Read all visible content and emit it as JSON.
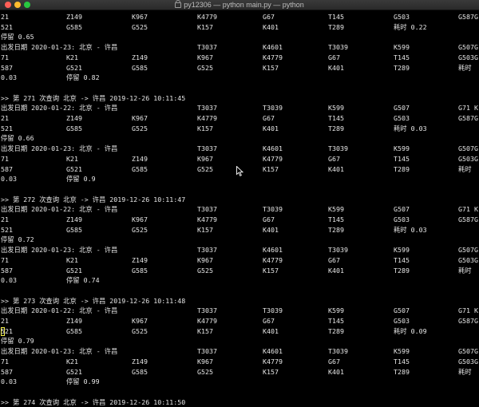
{
  "window": {
    "title": "py12306 — python main.py — python"
  },
  "terminal": {
    "lines": [
      [
        "21",
        "Z149",
        "K967",
        "K4779",
        "G67",
        "T145",
        "G503",
        "G587G"
      ],
      [
        "521",
        "G585",
        "G525",
        "K157",
        "K401",
        "T289",
        "耗时 0.22"
      ],
      [
        "停留 0.65"
      ],
      [
        "出发日期 2020-01-23: 北京 - 许昌",
        "T3037",
        "K4601",
        "T3039",
        "K599",
        "G507G"
      ],
      [
        "71",
        "K21",
        "Z149",
        "K967",
        "K4779",
        "G67",
        "T145",
        "G503G"
      ],
      [
        "587",
        "G521",
        "G585",
        "G525",
        "K157",
        "K401",
        "T289",
        "耗时"
      ],
      [
        "0.03",
        "停留 0.82"
      ],
      [
        ""
      ],
      [
        ">> 第 271 次查询 北京 -> 许昌 2019-12-26 10:11:45"
      ],
      [
        "出发日期 2020-01-22: 北京 - 许昌",
        "T3037",
        "T3039",
        "K599",
        "G507",
        "G71 K"
      ],
      [
        "21",
        "Z149",
        "K967",
        "K4779",
        "G67",
        "T145",
        "G503",
        "G587G"
      ],
      [
        "521",
        "G585",
        "G525",
        "K157",
        "K401",
        "T289",
        "耗时 0.03"
      ],
      [
        "停留 0.66"
      ],
      [
        "出发日期 2020-01-23: 北京 - 许昌",
        "T3037",
        "K4601",
        "T3039",
        "K599",
        "G507G"
      ],
      [
        "71",
        "K21",
        "Z149",
        "K967",
        "K4779",
        "G67",
        "T145",
        "G503G"
      ],
      [
        "587",
        "G521",
        "G585",
        "G525",
        "K157",
        "K401",
        "T289",
        "耗时"
      ],
      [
        "0.03",
        "停留 0.9"
      ],
      [
        ""
      ],
      [
        ">> 第 272 次查询 北京 -> 许昌 2019-12-26 10:11:47"
      ],
      [
        "出发日期 2020-01-22: 北京 - 许昌",
        "T3037",
        "T3039",
        "K599",
        "G507",
        "G71 K"
      ],
      [
        "21",
        "Z149",
        "K967",
        "K4779",
        "G67",
        "T145",
        "G503",
        "G587G"
      ],
      [
        "521",
        "G585",
        "G525",
        "K157",
        "K401",
        "T289",
        "耗时 0.03"
      ],
      [
        "停留 0.72"
      ],
      [
        "出发日期 2020-01-23: 北京 - 许昌",
        "T3037",
        "K4601",
        "T3039",
        "K599",
        "G507G"
      ],
      [
        "71",
        "K21",
        "Z149",
        "K967",
        "K4779",
        "G67",
        "T145",
        "G503G"
      ],
      [
        "587",
        "G521",
        "G585",
        "G525",
        "K157",
        "K401",
        "T289",
        "耗时"
      ],
      [
        "0.03",
        "停留 0.74"
      ],
      [
        ""
      ],
      [
        ">> 第 273 次查询 北京 -> 许昌 2019-12-26 10:11:48"
      ],
      [
        "出发日期 2020-01-22: 北京 - 许昌",
        "T3037",
        "T3039",
        "K599",
        "G507",
        "G71 K"
      ],
      [
        "21",
        "Z149",
        "K967",
        "K4779",
        "G67",
        "T145",
        "G503",
        "G587G"
      ],
      [
        "521",
        "G585",
        "G525",
        "K157",
        "K401",
        "T289",
        "耗时 0.09"
      ],
      [
        "停留 0.79"
      ],
      [
        "出发日期 2020-01-23: 北京 - 许昌",
        "T3037",
        "K4601",
        "T3039",
        "K599",
        "G507G"
      ],
      [
        "71",
        "K21",
        "Z149",
        "K967",
        "K4779",
        "G67",
        "T145",
        "G503G"
      ],
      [
        "587",
        "G521",
        "G585",
        "G525",
        "K157",
        "K401",
        "T289",
        "耗时"
      ],
      [
        "0.03",
        "停留 0.99"
      ],
      [
        ""
      ],
      [
        ">> 第 274 次查询 北京 -> 许昌 2019-12-26 10:11:50"
      ]
    ]
  },
  "colors": {
    "background": "#000000",
    "text": "#e6e6e6",
    "cursor": "#f2ef4a"
  },
  "icons": {
    "pointer": "mouse-pointer-icon",
    "lock": "lock-icon"
  }
}
